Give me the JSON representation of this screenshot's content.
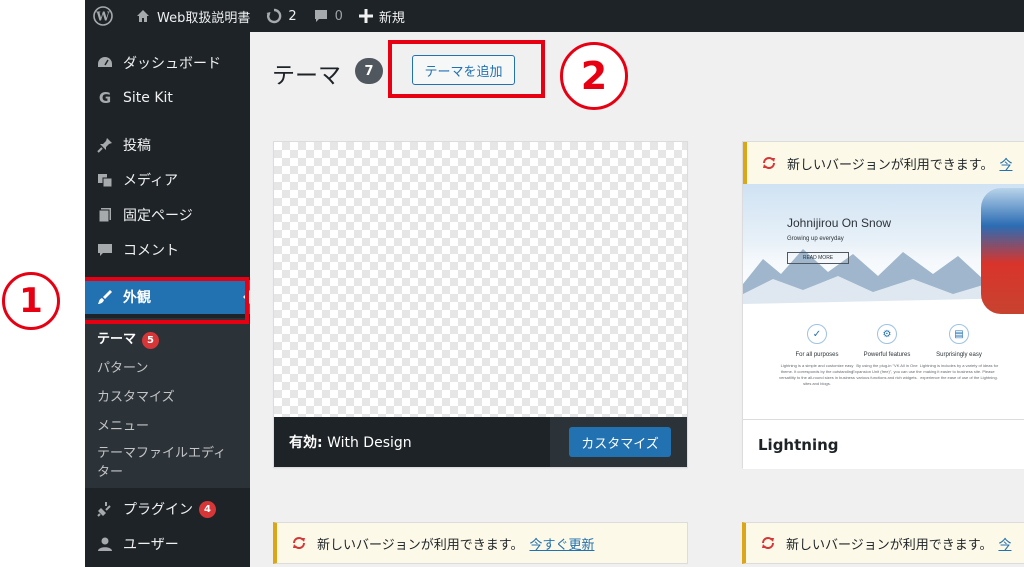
{
  "admin_bar": {
    "site_name": "Web取扱説明書",
    "updates_count": "2",
    "comments_count": "0",
    "new_label": "新規"
  },
  "sidebar": {
    "items": [
      {
        "label": "ダッシュボード",
        "icon": "dashboard-icon"
      },
      {
        "label": "Site Kit",
        "icon": "google-g-icon"
      },
      {
        "label": "投稿",
        "icon": "pin-icon"
      },
      {
        "label": "メディア",
        "icon": "media-icon"
      },
      {
        "label": "固定ページ",
        "icon": "pages-icon"
      },
      {
        "label": "コメント",
        "icon": "comment-icon"
      },
      {
        "label": "外観",
        "icon": "paintbrush-icon"
      },
      {
        "label": "プラグイン",
        "icon": "plugin-icon",
        "badge": "4"
      },
      {
        "label": "ユーザー",
        "icon": "users-icon"
      }
    ],
    "submenu": [
      {
        "label": "テーマ",
        "badge": "5"
      },
      {
        "label": "パターン"
      },
      {
        "label": "カスタマイズ"
      },
      {
        "label": "メニュー"
      },
      {
        "label": "テーマファイルエディター"
      }
    ]
  },
  "main": {
    "title": "テーマ",
    "theme_count": "7",
    "add_button": "テーマを追加"
  },
  "active_theme": {
    "prefix": "有効:",
    "name": "With Design",
    "customize_button": "カスタマイズ"
  },
  "theme2": {
    "notice": "新しいバージョンが利用できます。",
    "notice_link": "今",
    "name": "Lightning",
    "hero_title": "Johnijirou On Snow",
    "hero_sub": "Growing up everyday",
    "hero_button": "READ MORE",
    "features": [
      {
        "title": "For all purposes",
        "text": "Lightning is a simple and customize easy theme. It corresponds by the outstanding versatility to the all-round sizes in business sites and blogs."
      },
      {
        "title": "Powerful features",
        "text": "By using the plug-in \"VK All in One Expansion Unit (free)\", you can use the various functions and rich widgets."
      },
      {
        "title": "Surprisingly easy",
        "text": "Lightning is includes by a variety of ideas for making it easier to business site. Please experience the ease of use of the Lightning."
      }
    ]
  },
  "bottom_notices": [
    {
      "text": "新しいバージョンが利用できます。",
      "link": "今すぐ更新"
    },
    {
      "text": "新しいバージョンが利用できます。",
      "link": "今"
    }
  ],
  "annotations": {
    "step1": "1",
    "step2": "2"
  },
  "colors": {
    "accent": "#2271b1",
    "annotation": "#e60012",
    "sidebar_bg": "#1d2327"
  }
}
